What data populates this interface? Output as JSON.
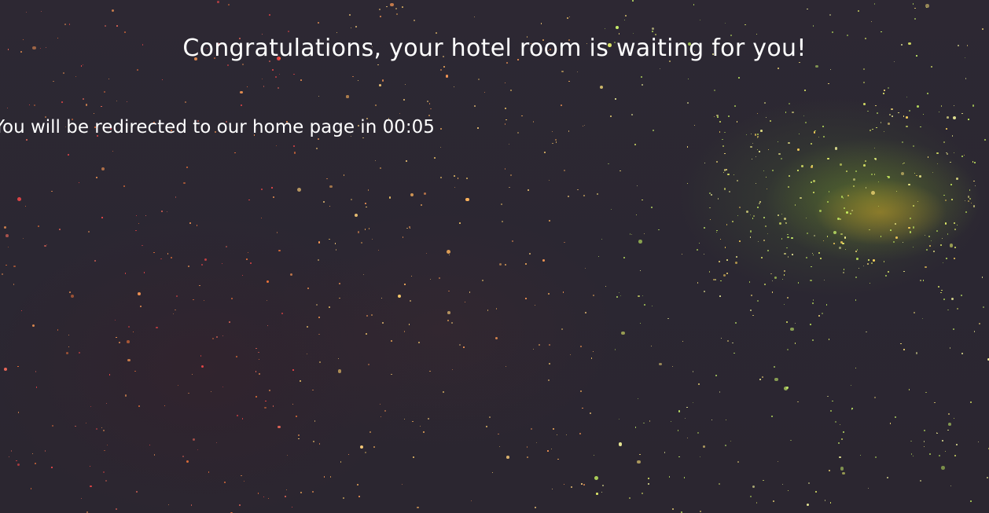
{
  "headline": "Congratulations, your hotel room is waiting for you!",
  "redirect": {
    "message": "You will be redirected to our home page in",
    "countdown": "00:05"
  },
  "background": {
    "image": "starry-night-sky",
    "base_color": "#2c2733",
    "nebula_color": "#8fae3a",
    "warm_star_color": "#ff8a3d",
    "red_star_color": "#ff2a44"
  }
}
